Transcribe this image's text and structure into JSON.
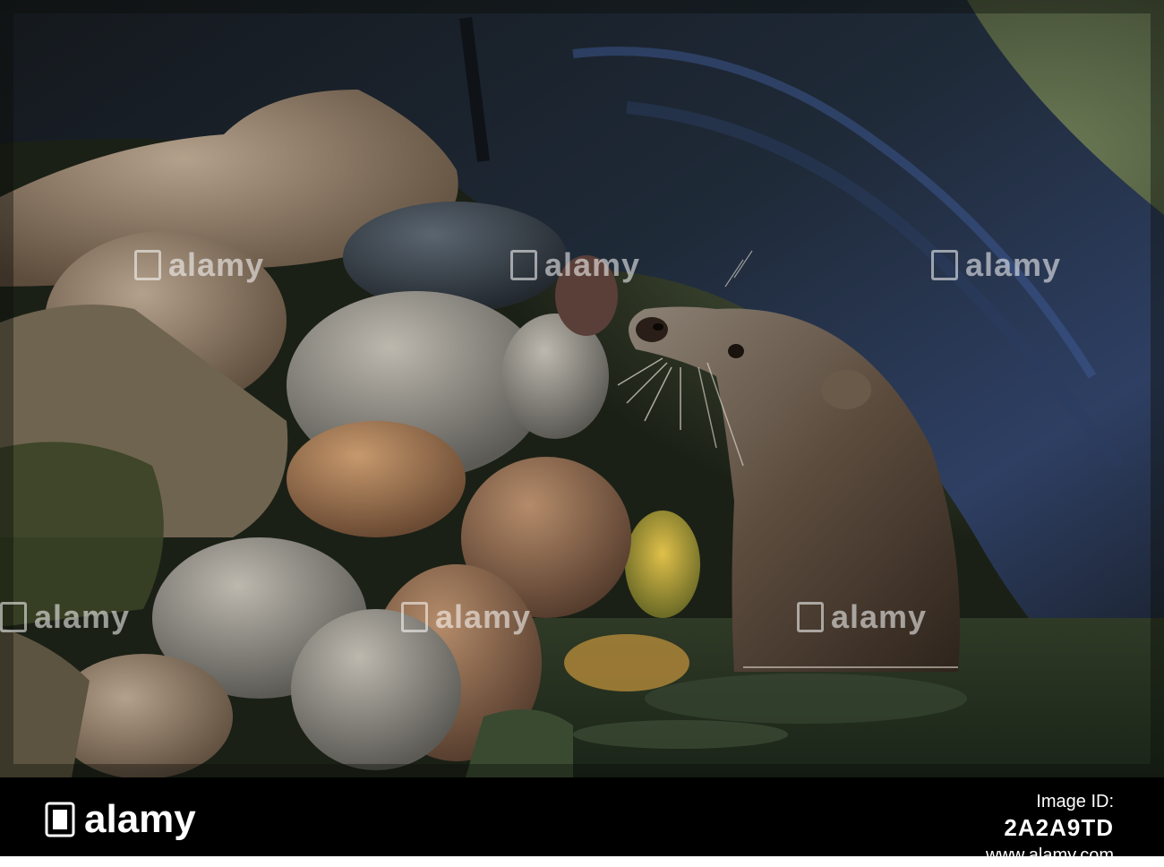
{
  "photo": {
    "subject": "otter",
    "watermark_text": "alamy",
    "colors": {
      "log": "#1d2733",
      "log_highlight": "#4a6fb5",
      "water": "#2c3a2c",
      "rock_warm": "#a88466",
      "rock_grey": "#8f8a83",
      "otter_fur": "#5b4a3c",
      "moss": "#c9a62e"
    }
  },
  "footer": {
    "logo_text": "alamy",
    "label": "Image ID:",
    "image_id": "2A2A9TD",
    "site": "www.alamy.com"
  }
}
